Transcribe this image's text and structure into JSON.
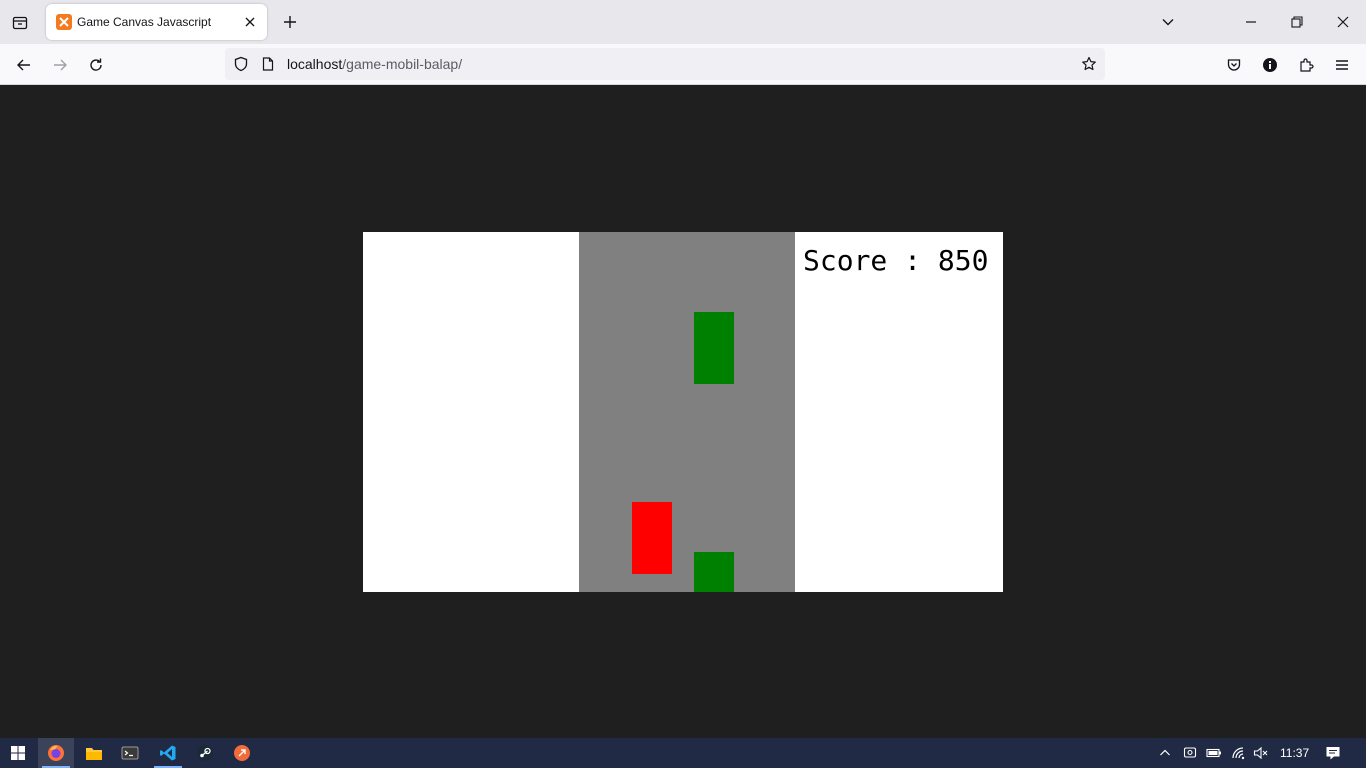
{
  "browser": {
    "tab": {
      "title": "Game Canvas Javascript",
      "favicon": "xampp-icon"
    },
    "url": {
      "host": "localhost",
      "path": "/game-mobil-balap/"
    },
    "icons": {
      "tab_list": "tab-list-icon",
      "new_tab": "plus-icon",
      "back": "back-arrow-icon",
      "forward": "forward-arrow-icon",
      "reload": "reload-icon",
      "bookmark": "star-icon",
      "pocket": "pocket-icon",
      "info": "info-icon",
      "extensions": "puzzle-icon",
      "menu": "hamburger-icon"
    }
  },
  "game": {
    "score_label": "Score : 850",
    "score": 850,
    "colors": {
      "background": "#ffffff",
      "road": "#808080",
      "player_car": "#ff0000",
      "enemy_car": "#008000",
      "page_background": "#1f1f1f"
    }
  },
  "taskbar": {
    "apps": [
      "windows-start-icon",
      "firefox-icon",
      "file-explorer-icon",
      "terminal-icon",
      "vscode-icon",
      "steam-icon",
      "app-icon"
    ],
    "clock": "11:37"
  }
}
